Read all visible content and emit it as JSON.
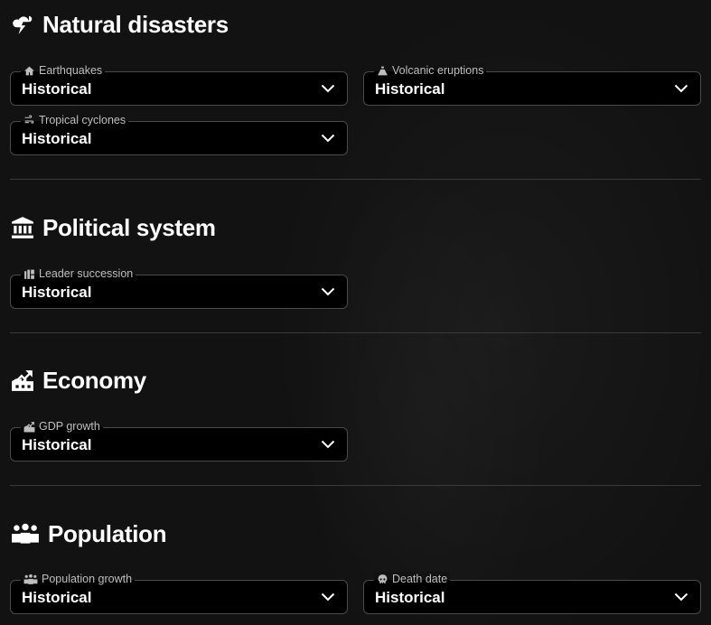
{
  "sections": {
    "natural_disasters": {
      "title": "Natural disasters",
      "fields": {
        "earthquakes": {
          "label": "Earthquakes",
          "value": "Historical"
        },
        "volcanic": {
          "label": "Volcanic eruptions",
          "value": "Historical"
        },
        "cyclones": {
          "label": "Tropical cyclones",
          "value": "Historical"
        }
      }
    },
    "political_system": {
      "title": "Political system",
      "fields": {
        "leader": {
          "label": "Leader succession",
          "value": "Historical"
        }
      }
    },
    "economy": {
      "title": "Economy",
      "fields": {
        "gdp": {
          "label": "GDP growth",
          "value": "Historical"
        }
      }
    },
    "population": {
      "title": "Population",
      "fields": {
        "growth": {
          "label": "Population growth",
          "value": "Historical"
        },
        "death": {
          "label": "Death date",
          "value": "Historical"
        }
      }
    }
  },
  "colors": {
    "background": "#121212",
    "field_background": "#000000",
    "field_border": "#4a4a4a",
    "label_text": "#bdbdbd",
    "text": "#ffffff"
  },
  "icons": {
    "natural_disasters": "storm-cloud-icon",
    "political_system": "government-building-icon",
    "economy": "factory-chart-icon",
    "population": "people-group-icon",
    "earthquakes": "house-icon",
    "volcanic": "volcano-icon",
    "cyclones": "wind-icon",
    "leader": "leader-succession-icon",
    "gdp": "factory-icon",
    "growth": "people-icon",
    "death": "skull-icon",
    "dropdown": "chevron-down-icon"
  }
}
